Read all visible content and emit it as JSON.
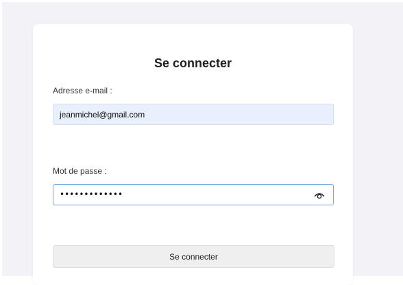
{
  "login": {
    "title": "Se connecter",
    "email": {
      "label": "Adresse e-mail :",
      "value": "jeanmichel@gmail.com"
    },
    "password": {
      "label": "Mot de passe :",
      "masked_value": "•••••••••••••",
      "toggle_icon": "eye-icon"
    },
    "submit_label": "Se connecter"
  },
  "colors": {
    "page_background": "#f2f2f7",
    "card_background": "#ffffff",
    "email_field_background": "#e8f0fe",
    "password_field_border": "#7aa7d8",
    "button_background": "#efefef"
  }
}
